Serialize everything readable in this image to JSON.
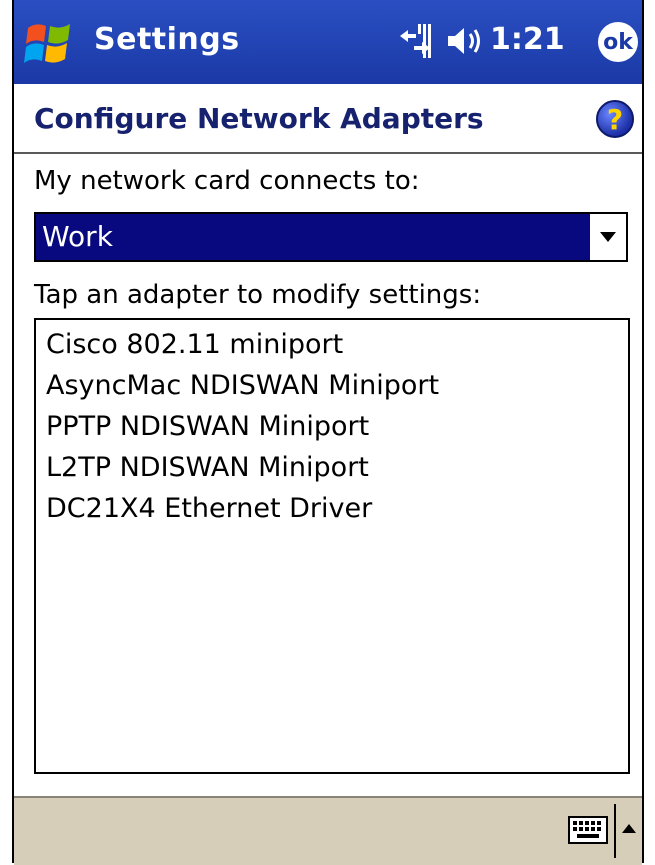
{
  "titlebar": {
    "app_title": "Settings",
    "clock": "1:21",
    "ok_label": "ok",
    "start_icon": "windows-flag-icon",
    "signal_icon": "connectivity-icon",
    "speaker_icon": "speaker-icon"
  },
  "header": {
    "page_title": "Configure Network Adapters",
    "help_label": "?"
  },
  "form": {
    "connects_label": "My network card connects to:",
    "connects_value": "Work",
    "adapters_label": "Tap an adapter to modify settings:",
    "adapters": [
      "Cisco 802.11 miniport",
      "AsyncMac NDISWAN Miniport",
      "PPTP NDISWAN Miniport",
      "L2TP NDISWAN Miniport",
      "DC21X4 Ethernet Driver"
    ]
  },
  "bottombar": {
    "keyboard_icon": "keyboard-icon",
    "sip_arrow_icon": "up-arrow-icon"
  },
  "colors": {
    "titlebar": "#1b39a6",
    "selection": "#08097f",
    "header_text": "#17226e",
    "bottom_bar": "#d6ceb8"
  }
}
